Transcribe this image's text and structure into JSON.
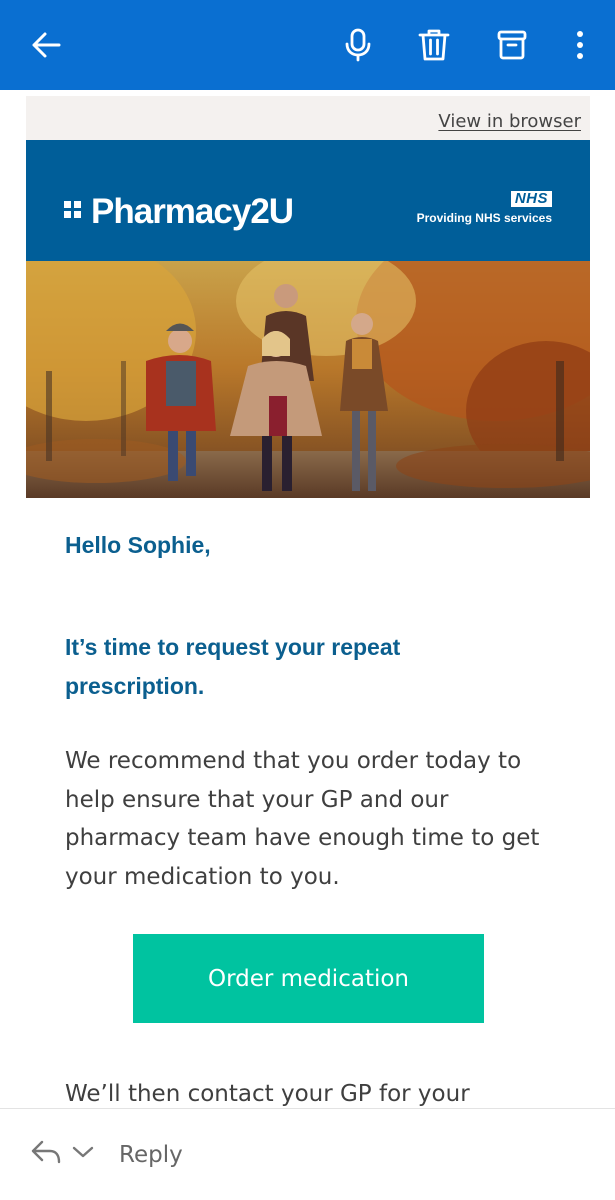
{
  "colors": {
    "appbar": "#0a6fd1",
    "brand_band": "#005e99",
    "heading_text": "#0b5f8f",
    "body_text": "#3f3f3f",
    "cta_background": "#00c3a0",
    "browser_bar": "#f4f1ef"
  },
  "toolbar": {
    "back_icon": "arrow-left-icon",
    "actions": [
      {
        "name": "microphone-icon"
      },
      {
        "name": "trash-icon"
      },
      {
        "name": "archive-icon"
      },
      {
        "name": "more-vertical-icon"
      }
    ]
  },
  "email": {
    "view_in_browser": "View in browser",
    "brand": {
      "logo_text": "Pharmacy2U",
      "nhs_badge": "NHS",
      "nhs_tagline": "Providing NHS services"
    },
    "hero_image": "family-autumn-walk-photo",
    "greeting": "Hello Sophie,",
    "headline_line1": "It’s time to request your repeat",
    "headline_line2": "prescription.",
    "body_lines": [
      "We recommend that you order today to",
      "help ensure that your GP and our",
      "pharmacy team have enough time to get",
      "your medication to you."
    ],
    "cta_label": "Order medication",
    "trailing_text": "We’ll then contact your GP for your"
  },
  "reply_bar": {
    "reply_icon": "reply-icon",
    "options_icon": "chevron-down-icon",
    "label": "Reply"
  }
}
